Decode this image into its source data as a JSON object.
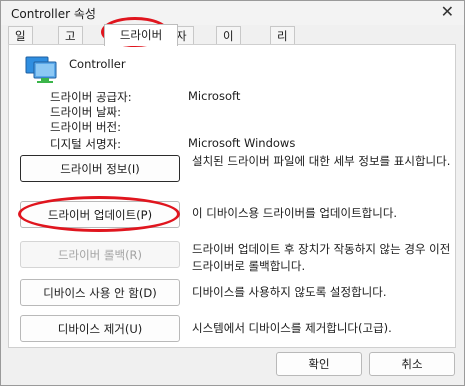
{
  "window": {
    "title": "Controller 속성",
    "close_glyph": "✕"
  },
  "tabs": [
    {
      "label": "일반"
    },
    {
      "label": "고급"
    },
    {
      "label": "드라이버"
    },
    {
      "label": "자세히"
    },
    {
      "label": "이벤트"
    },
    {
      "label": "리소스"
    }
  ],
  "device": {
    "name": "Controller",
    "icon": "monitor-icon"
  },
  "info": [
    {
      "label": "드라이버 공급자:",
      "value": "Microsoft"
    },
    {
      "label": "드라이버 날짜:",
      "value": ""
    },
    {
      "label": "드라이버 버전:",
      "value": ""
    },
    {
      "label": "디지털 서명자:",
      "value": "Microsoft Windows"
    }
  ],
  "actions": [
    {
      "label": "드라이버 정보(I)",
      "desc": "설치된 드라이버 파일에 대한 세부 정보를 표시합니다."
    },
    {
      "label": "드라이버 업데이트(P)",
      "desc": "이 디바이스용 드라이버를 업데이트합니다."
    },
    {
      "label": "드라이버 롤백(R)",
      "desc": "드라이버 업데이트 후 장치가 작동하지 않는 경우 이전 드라이버로 롤백합니다."
    },
    {
      "label": "디바이스 사용 안 함(D)",
      "desc": "디바이스를 사용하지 않도록 설정합니다."
    },
    {
      "label": "디바이스 제거(U)",
      "desc": "시스템에서 디바이스를 제거합니다(고급)."
    }
  ],
  "footer": {
    "ok_label": "확인",
    "cancel_label": "취소"
  },
  "colors": {
    "annotation_red": "#e0151e",
    "icon_blue": "#2f8ee0",
    "icon_green": "#3bb54a"
  }
}
